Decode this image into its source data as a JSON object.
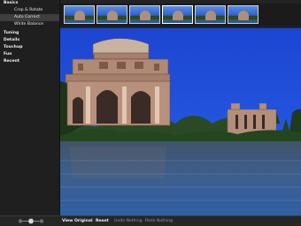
{
  "sidebar": {
    "categories": [
      {
        "label": "Basics",
        "items": [
          {
            "label": "Crop & Rotate"
          },
          {
            "label": "Auto Correct"
          },
          {
            "label": "White Balance"
          }
        ]
      },
      {
        "label": "Tuning"
      },
      {
        "label": "Details"
      },
      {
        "label": "Touchup"
      },
      {
        "label": "Fun"
      },
      {
        "label": "Recent"
      }
    ]
  },
  "filmstrip": {
    "selected_index": 3,
    "thumbnail_count": 6
  },
  "bottombar": {
    "view_original": "View Original",
    "reset": "Reset",
    "undo": "Undo Nothing",
    "redo": "Redo Nothing"
  },
  "colors": {
    "sky": "#1f4bd8",
    "sidebar_bg": "#1f1f1f",
    "selected_item_bg": "#3e3e3e"
  }
}
